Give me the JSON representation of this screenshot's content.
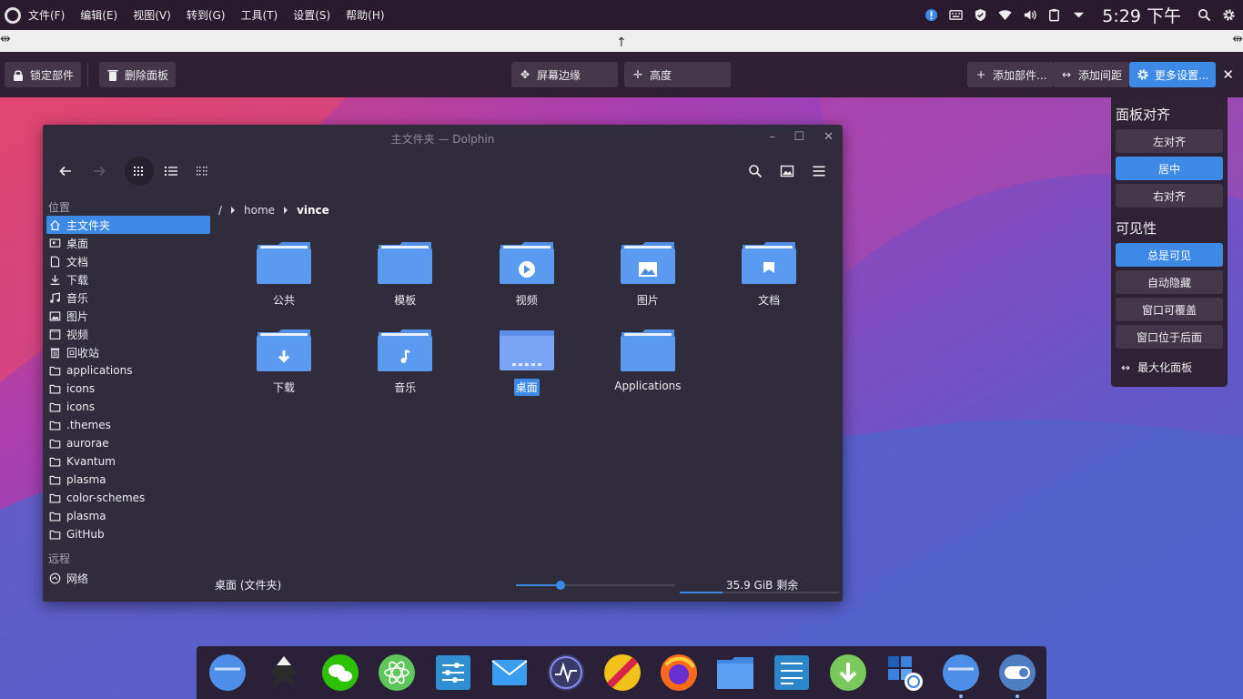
{
  "menubar": {
    "items": [
      "文件(F)",
      "编辑(E)",
      "视图(V)",
      "转到(G)",
      "工具(T)",
      "设置(S)",
      "帮助(H)"
    ],
    "clock": "5:29 下午",
    "tray_icons": [
      "notification-icon",
      "keyboard-icon",
      "shield-icon",
      "wifi-icon",
      "volume-icon",
      "clipboard-icon",
      "expand-icon",
      "search-icon",
      "gear-icon"
    ]
  },
  "panel_tools": {
    "lock": "锁定部件",
    "remove": "删除面板",
    "screen_edge": "屏幕边缘",
    "height": "高度",
    "add_widget": "添加部件...",
    "add_spacer": "添加间距",
    "more_settings": "更多设置..."
  },
  "panel_settings": {
    "align_title": "面板对齐",
    "align_options": [
      "左对齐",
      "居中",
      "右对齐"
    ],
    "align_selected": "居中",
    "visibility_title": "可见性",
    "visibility_options": [
      "总是可见",
      "自动隐藏",
      "窗口可覆盖",
      "窗口位于后面"
    ],
    "visibility_selected": "总是可见",
    "maximize": "最大化面板"
  },
  "window": {
    "title": "主文件夹 — Dolphin",
    "sidebar": {
      "places_header": "位置",
      "places": [
        {
          "label": "主文件夹",
          "icon": "home-icon"
        },
        {
          "label": "桌面",
          "icon": "desktop-icon"
        },
        {
          "label": "文档",
          "icon": "document-icon"
        },
        {
          "label": "下载",
          "icon": "download-icon"
        },
        {
          "label": "音乐",
          "icon": "music-icon"
        },
        {
          "label": "图片",
          "icon": "picture-icon"
        },
        {
          "label": "视频",
          "icon": "video-icon"
        },
        {
          "label": "回收站",
          "icon": "trash-icon"
        },
        {
          "label": "applications",
          "icon": "folder-icon"
        },
        {
          "label": "icons",
          "icon": "folder-icon"
        },
        {
          "label": "icons",
          "icon": "folder-icon"
        },
        {
          "label": ".themes",
          "icon": "folder-icon"
        },
        {
          "label": "aurorae",
          "icon": "folder-icon"
        },
        {
          "label": "Kvantum",
          "icon": "folder-icon"
        },
        {
          "label": "plasma",
          "icon": "folder-icon"
        },
        {
          "label": "color-schemes",
          "icon": "folder-icon"
        },
        {
          "label": "plasma",
          "icon": "folder-icon"
        },
        {
          "label": "GitHub",
          "icon": "folder-icon"
        }
      ],
      "active_place": "主文件夹",
      "remote_header": "远程",
      "remote": [
        {
          "label": "网络",
          "icon": "network-icon"
        }
      ]
    },
    "breadcrumb": [
      "/",
      "home",
      "vince"
    ],
    "folders": [
      {
        "label": "公共",
        "emblem": "none"
      },
      {
        "label": "模板",
        "emblem": "none"
      },
      {
        "label": "视频",
        "emblem": "play"
      },
      {
        "label": "图片",
        "emblem": "image"
      },
      {
        "label": "文档",
        "emblem": "doc"
      },
      {
        "label": "下载",
        "emblem": "download"
      },
      {
        "label": "音乐",
        "emblem": "music"
      },
      {
        "label": "桌面",
        "emblem": "desktop"
      },
      {
        "label": "Applications",
        "emblem": "none"
      }
    ],
    "selected_folder": "桌面",
    "status": {
      "selection": "桌面 (文件夹)",
      "free_space": "35.9 GiB 剩余",
      "zoom_fraction": 0.28,
      "disk_used_fraction": 0.27
    }
  },
  "dock": {
    "apps": [
      "finder-icon",
      "inkscape-icon",
      "wechat-icon",
      "atom-icon",
      "settings-sliders-icon",
      "mail-icon",
      "system-monitor-icon",
      "colorpicker-icon",
      "firefox-icon",
      "files-icon",
      "preferences-icon",
      "downloader-icon",
      "workspace-icon",
      "dolphin-icon",
      "toggle-icon"
    ]
  },
  "colors": {
    "accent": "#3d8ae6",
    "window_bg": "#312c3c",
    "panel_bg": "#2e1f33"
  }
}
